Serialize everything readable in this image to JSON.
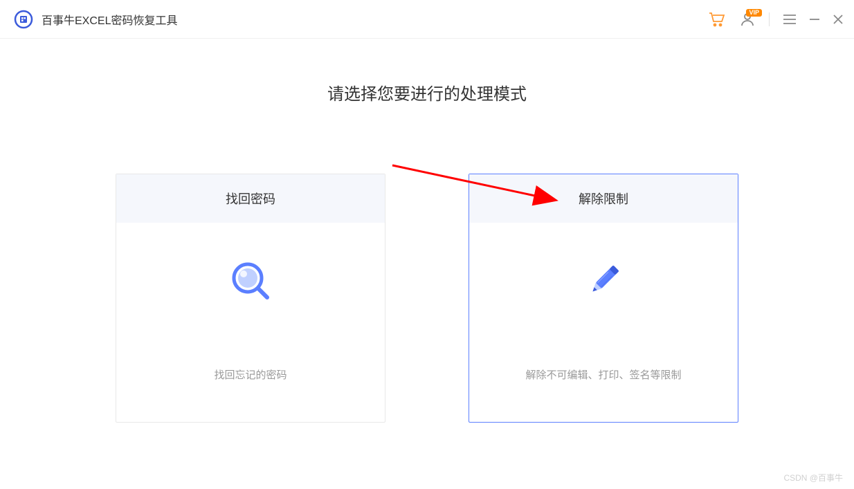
{
  "app": {
    "title": "百事牛EXCEL密码恢复工具"
  },
  "titlebar": {
    "cart_icon": "cart-icon",
    "user_icon": "user-icon",
    "vip_badge": "VIP",
    "menu_icon": "menu-icon",
    "minimize_icon": "minimize-icon",
    "close_icon": "close-icon"
  },
  "main": {
    "heading": "请选择您要进行的处理模式",
    "cards": [
      {
        "title": "找回密码",
        "description": "找回忘记的密码",
        "selected": false
      },
      {
        "title": "解除限制",
        "description": "解除不可编辑、打印、签名等限制",
        "selected": true
      }
    ]
  },
  "watermark": "CSDN @百事牛",
  "colors": {
    "accent": "#5b7fff",
    "orange": "#ff9933",
    "arrow": "#ff0000"
  }
}
